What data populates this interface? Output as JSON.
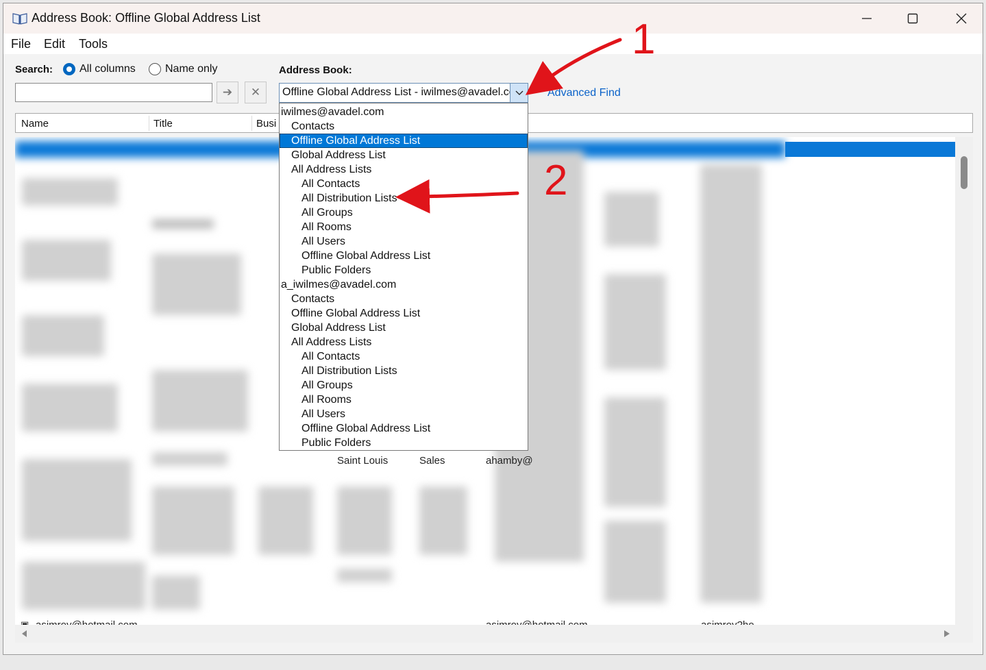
{
  "window": {
    "title": "Address Book: Offline Global Address List",
    "icon": "address-book-icon",
    "controls": [
      "minimize-icon",
      "maximize-icon",
      "close-icon"
    ]
  },
  "menu": [
    "File",
    "Edit",
    "Tools"
  ],
  "search": {
    "label": "Search:",
    "options": [
      "All columns",
      "Name only"
    ],
    "selected": "All columns",
    "value": "",
    "go_icon": "arrow-right-icon",
    "clear_icon": "x-icon"
  },
  "address_book": {
    "label": "Address Book:",
    "selected": "Offline Global Address List - iwilmes@avadel.co",
    "advanced_find": "Advanced Find",
    "dropdown": [
      {
        "text": "iwilmes@avadel.com",
        "level": 0
      },
      {
        "text": "Contacts",
        "level": 1
      },
      {
        "text": "Offline Global Address List",
        "level": 1,
        "highlighted": true
      },
      {
        "text": "Global Address List",
        "level": 1
      },
      {
        "text": "All Address Lists",
        "level": 1
      },
      {
        "text": "All Contacts",
        "level": 2
      },
      {
        "text": "All Distribution Lists",
        "level": 2
      },
      {
        "text": "All Groups",
        "level": 2
      },
      {
        "text": "All Rooms",
        "level": 2
      },
      {
        "text": "All Users",
        "level": 2
      },
      {
        "text": "Offline Global Address List",
        "level": 2
      },
      {
        "text": "Public Folders",
        "level": 2
      },
      {
        "text": "a_iwilmes@avadel.com",
        "level": 0
      },
      {
        "text": "Contacts",
        "level": 1
      },
      {
        "text": "Offline Global Address List",
        "level": 1
      },
      {
        "text": "Global Address List",
        "level": 1
      },
      {
        "text": "All Address Lists",
        "level": 1
      },
      {
        "text": "All Contacts",
        "level": 2
      },
      {
        "text": "All Distribution Lists",
        "level": 2
      },
      {
        "text": "All Groups",
        "level": 2
      },
      {
        "text": "All Rooms",
        "level": 2
      },
      {
        "text": "All Users",
        "level": 2
      },
      {
        "text": "Offline Global Address List",
        "level": 2
      },
      {
        "text": "Public Folders",
        "level": 2
      }
    ]
  },
  "columns": [
    "Name",
    "Title",
    "Busi"
  ],
  "rows_visible": {
    "partial_row": {
      "location": "Saint Louis",
      "department": "Sales",
      "email": "ahamby@"
    },
    "last_row": {
      "name": "asimroy@hotmail.com",
      "email": "asimroy@hotmail.com",
      "alias": "asimroy?ho"
    }
  },
  "annotations": [
    "1",
    "2"
  ],
  "colors": {
    "selection": "#0078d7",
    "link": "#0a62c9",
    "annotation": "#e0141a"
  }
}
